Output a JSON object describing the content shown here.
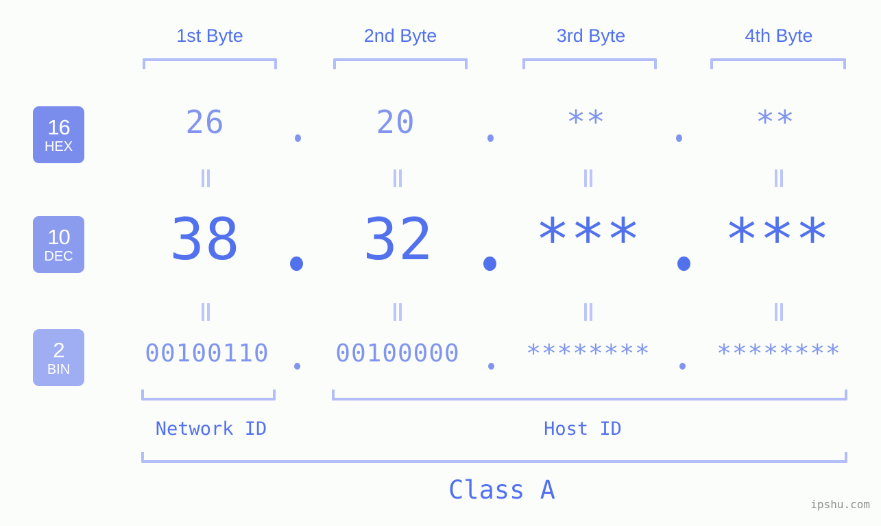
{
  "background_color": "#fbfdfa",
  "colors": {
    "primary": "#5271ed",
    "light": "#8195ee",
    "bracket": "#b3bdf7",
    "connector": "#bcc6f8",
    "watermark": "#8f8f8f",
    "badge_hex": "#7a8ded",
    "badge_dec": "#8b9cef",
    "badge_bin": "#9fadf3"
  },
  "headers": [
    {
      "label": "1st Byte"
    },
    {
      "label": "2nd Byte"
    },
    {
      "label": "3rd Byte"
    },
    {
      "label": "4th Byte"
    }
  ],
  "badges": [
    {
      "num": "16",
      "name": "HEX"
    },
    {
      "num": "10",
      "name": "DEC"
    },
    {
      "num": "2",
      "name": "BIN"
    }
  ],
  "rows": {
    "hex": {
      "values": [
        "26",
        "20",
        "**",
        "**"
      ]
    },
    "dec": {
      "values": [
        "38",
        "32",
        "***",
        "***"
      ]
    },
    "bin": {
      "values": [
        "00100110",
        "00100000",
        "********",
        "********"
      ]
    }
  },
  "separator": ".",
  "connector": "=",
  "segments": [
    {
      "label": "Network ID"
    },
    {
      "label": "Host ID"
    }
  ],
  "class": {
    "label": "Class A"
  },
  "watermark": "ipshu.com"
}
